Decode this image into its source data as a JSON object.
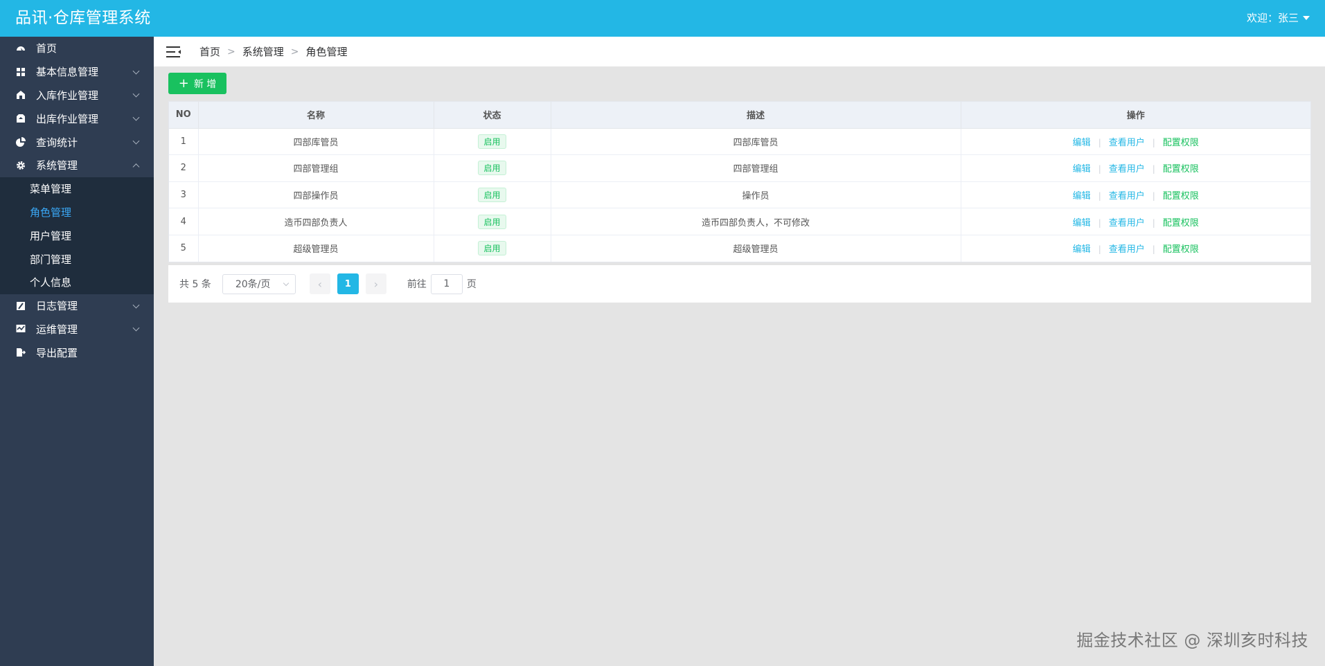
{
  "app": {
    "title": "品讯·仓库管理系统",
    "welcome": "欢迎：张三"
  },
  "sidebar": {
    "items": [
      {
        "label": "首页",
        "icon": "dashboard-icon"
      },
      {
        "label": "基本信息管理",
        "icon": "grid-icon"
      },
      {
        "label": "入库作业管理",
        "icon": "warehouse-in-icon"
      },
      {
        "label": "出库作业管理",
        "icon": "box-out-icon"
      },
      {
        "label": "查询统计",
        "icon": "pie-chart-icon"
      },
      {
        "label": "系统管理",
        "icon": "gear-icon"
      },
      {
        "label": "日志管理",
        "icon": "log-icon"
      },
      {
        "label": "运维管理",
        "icon": "monitor-icon"
      },
      {
        "label": "导出配置",
        "icon": "export-icon"
      }
    ],
    "submenu": [
      {
        "label": "菜单管理"
      },
      {
        "label": "角色管理"
      },
      {
        "label": "用户管理"
      },
      {
        "label": "部门管理"
      },
      {
        "label": "个人信息"
      }
    ]
  },
  "breadcrumb": [
    "首页",
    "系统管理",
    "角色管理"
  ],
  "toolbar": {
    "add_label": "新 增"
  },
  "table": {
    "headers": [
      "NO",
      "名称",
      "状态",
      "描述",
      "操作"
    ],
    "rows": [
      {
        "no": "1",
        "name": "四部库管员",
        "status": "启用",
        "desc": "四部库管员"
      },
      {
        "no": "2",
        "name": "四部管理组",
        "status": "启用",
        "desc": "四部管理组"
      },
      {
        "no": "3",
        "name": "四部操作员",
        "status": "启用",
        "desc": "操作员"
      },
      {
        "no": "4",
        "name": "造币四部负责人",
        "status": "启用",
        "desc": "造币四部负责人，不可修改"
      },
      {
        "no": "5",
        "name": "超级管理员",
        "status": "启用",
        "desc": "超级管理员"
      }
    ],
    "actions": {
      "edit": "编辑",
      "view_users": "查看用户",
      "permissions": "配置权限"
    }
  },
  "pagination": {
    "total": "共 5 条",
    "page_size": "20条/页",
    "current_page": "1",
    "goto_prefix": "前往",
    "goto_value": "1",
    "goto_suffix": "页"
  },
  "watermark": "掘金技术社区 @ 深圳亥时科技",
  "colors": {
    "topbar": "#23b7e5",
    "sidebar": "#2f3d52",
    "submenu": "#1f2d3d",
    "active_link": "#3aa7f5",
    "success": "#19c15f"
  }
}
